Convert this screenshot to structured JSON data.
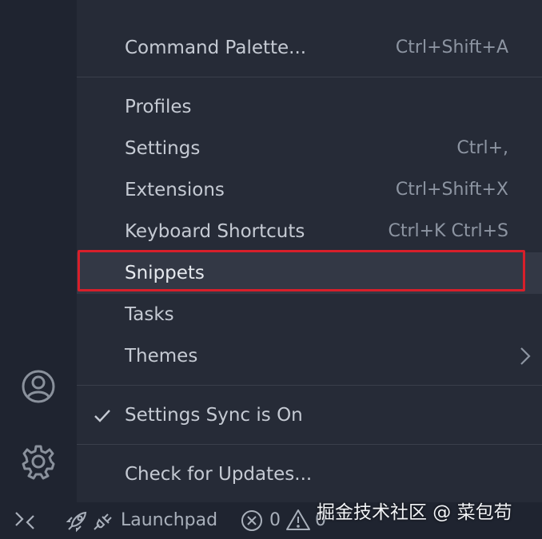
{
  "menu": {
    "items": [
      {
        "label": "Command Palette...",
        "shortcut": "Ctrl+Shift+A"
      },
      {
        "label": "Profiles",
        "shortcut": ""
      },
      {
        "label": "Settings",
        "shortcut": "Ctrl+,"
      },
      {
        "label": "Extensions",
        "shortcut": "Ctrl+Shift+X"
      },
      {
        "label": "Keyboard Shortcuts",
        "shortcut": "Ctrl+K Ctrl+S"
      },
      {
        "label": "Snippets",
        "shortcut": ""
      },
      {
        "label": "Tasks",
        "shortcut": ""
      },
      {
        "label": "Themes",
        "shortcut": "",
        "submenu": true
      },
      {
        "label": "Settings Sync is On",
        "checked": true
      },
      {
        "label": "Check for Updates..."
      }
    ],
    "highlighted_item": "Snippets",
    "highlight_color": "#d81f2a"
  },
  "activity_bar": {
    "icons": [
      "accounts-icon",
      "gear-icon"
    ]
  },
  "status_bar": {
    "remote_icon": "remote-icon",
    "launchpad_label": "Launchpad",
    "errors": "0",
    "warnings": "0"
  },
  "watermark": {
    "text": "掘金技术社区 @ 菜包苟"
  }
}
